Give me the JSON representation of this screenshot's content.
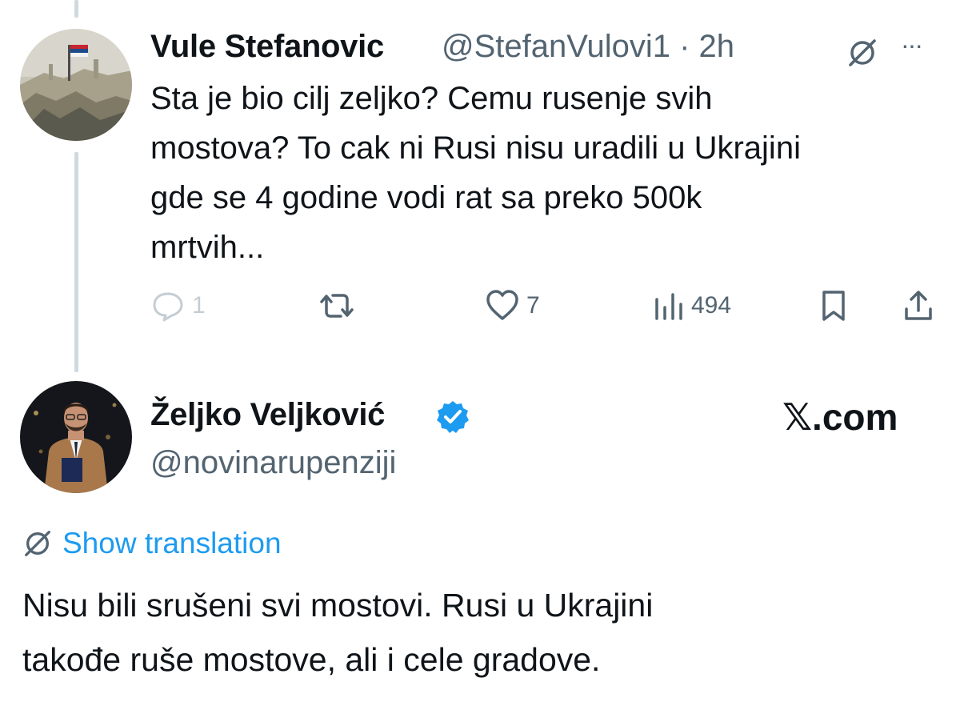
{
  "reply": {
    "author_name": "Vule Stefanovic",
    "handle_time": "@StefanVulovi1 · 2h",
    "text_lines": [
      "Sta je bio cilj zeljko? Cemu rusenje svih",
      "mostova? To cak ni Rusi nisu uradili u Ukrajini",
      "gde se 4 godine vodi rat sa preko 500k",
      "mrtvih..."
    ],
    "actions": {
      "replies": "1",
      "likes": "7",
      "views": "494"
    },
    "more_label": "···"
  },
  "main": {
    "author_name": "Željko Veljković",
    "handle": "@novinarupenziji",
    "watermark": "𝕏.com",
    "show_translation": "Show translation",
    "text_lines": [
      "Nisu bili srušeni svi mostovi. Rusi u Ukrajini",
      "takođe ruše mostove, ali i cele gradove."
    ]
  },
  "colors": {
    "accent": "#1d9bf0",
    "muted": "#536471",
    "text": "#0f1419"
  }
}
